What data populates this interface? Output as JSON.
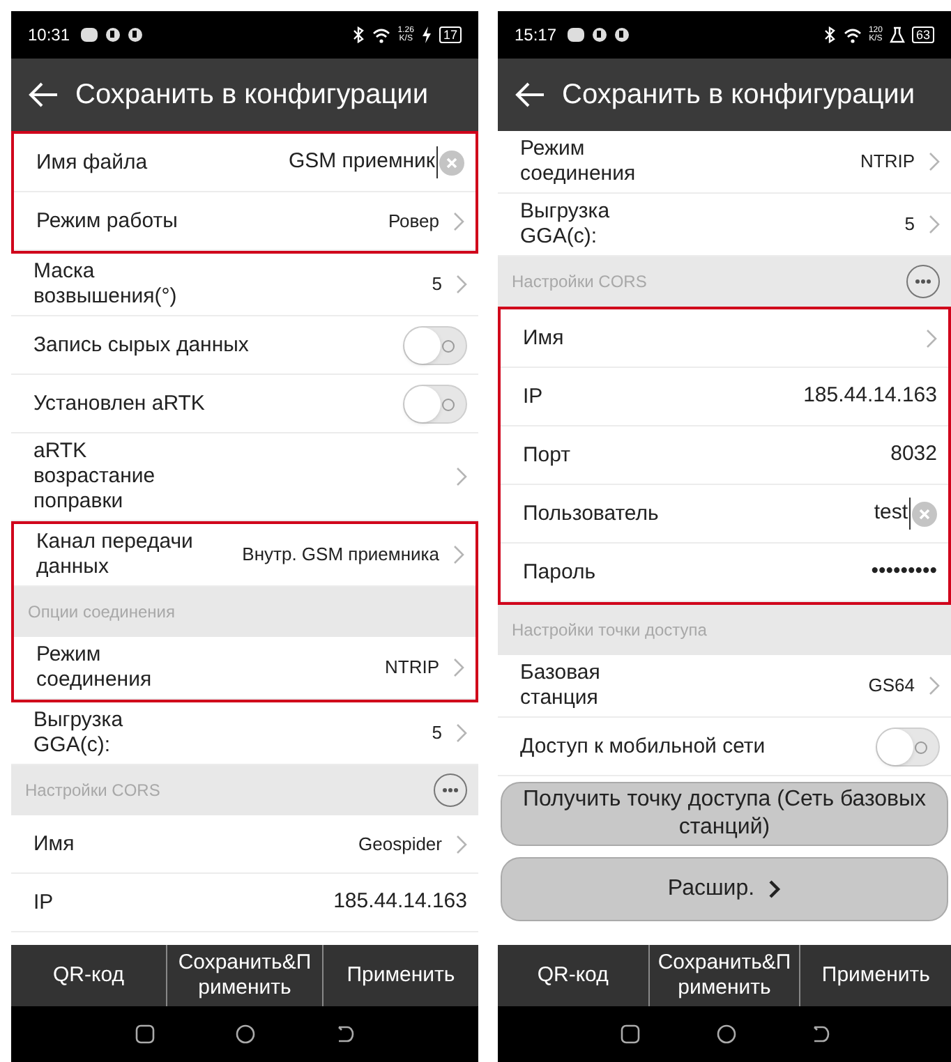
{
  "phones": [
    {
      "status_bar": {
        "time": "10:31",
        "speed_value": "1.26",
        "speed_unit": "K/S",
        "charging": true,
        "battery": "17"
      },
      "header": {
        "title": "Сохранить в конфигурации"
      },
      "blocks": [
        {
          "highlighted": true,
          "rows": [
            {
              "kind": "input",
              "label": "Имя файла",
              "value": "GSM приемник",
              "focused": true
            },
            {
              "kind": "select",
              "label": "Режим работы",
              "value": "Ровер"
            }
          ]
        },
        {
          "highlighted": false,
          "rows": [
            {
              "kind": "select",
              "label": "Маска\nвозвышения(°)",
              "value": "5"
            },
            {
              "kind": "toggle",
              "label": "Запись сырых данных",
              "on": false
            },
            {
              "kind": "toggle",
              "label": "Установлен aRTK",
              "on": false
            },
            {
              "kind": "select",
              "label": "aRTK\nвозрастание\nпоправки"
            }
          ]
        },
        {
          "highlighted": true,
          "rows": [
            {
              "kind": "select",
              "label": "Канал передачи\nданных",
              "value": "Внутр. GSM приемника"
            },
            {
              "kind": "section",
              "label": "Опции соединения",
              "more_button": false
            },
            {
              "kind": "select",
              "label": "Режим\nсоединения",
              "value": "NTRIP"
            }
          ]
        },
        {
          "highlighted": false,
          "rows": [
            {
              "kind": "select",
              "label": "Выгрузка\nGGA(c):",
              "value": "5"
            },
            {
              "kind": "section",
              "label": "Настройки CORS",
              "more_button": true
            },
            {
              "kind": "select",
              "label": "Имя",
              "value": "Geospider"
            },
            {
              "kind": "input",
              "label": "IP",
              "value": "185.44.14.163",
              "focused": false
            }
          ]
        }
      ],
      "bottom_bar": [
        "QR-код",
        "Сохранить&П\nрименить",
        "Применить"
      ]
    },
    {
      "status_bar": {
        "time": "15:17",
        "speed_value": "120",
        "speed_unit": "K/S",
        "charging": false,
        "battery": "63"
      },
      "header": {
        "title": "Сохранить в конфигурации"
      },
      "blocks": [
        {
          "highlighted": false,
          "rows": [
            {
              "kind": "select",
              "label": "Режим\nсоединения",
              "value": "NTRIP"
            },
            {
              "kind": "select",
              "label": "Выгрузка\nGGA(c):",
              "value": "5"
            },
            {
              "kind": "section",
              "label": "Настройки CORS",
              "more_button": true
            }
          ]
        },
        {
          "highlighted": true,
          "rows": [
            {
              "kind": "select",
              "label": "Имя"
            },
            {
              "kind": "input",
              "label": "IP",
              "value": "185.44.14.163",
              "focused": false
            },
            {
              "kind": "input",
              "label": "Порт",
              "value": "8032",
              "focused": false
            },
            {
              "kind": "input",
              "label": "Пользователь",
              "value": "test",
              "focused": true
            },
            {
              "kind": "input",
              "label": "Пароль",
              "value": "•••••••••",
              "focused": false
            }
          ]
        },
        {
          "highlighted": false,
          "rows": [
            {
              "kind": "section",
              "label": "Настройки точки доступа",
              "more_button": false
            },
            {
              "kind": "select",
              "label": "Базовая\nстанция",
              "value": "GS64"
            },
            {
              "kind": "toggle",
              "label": "Доступ к мобильной сети",
              "on": false
            }
          ]
        }
      ],
      "action_buttons": [
        {
          "label": "Получить точку доступа (Сеть базовых станций)",
          "chevron": false
        },
        {
          "label": "Расшир.",
          "chevron": true
        }
      ],
      "bottom_bar": [
        "QR-код",
        "Сохранить&П\nрименить",
        "Применить"
      ]
    }
  ]
}
